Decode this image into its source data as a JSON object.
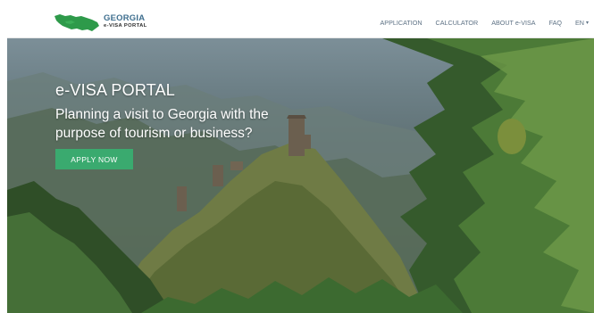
{
  "header": {
    "logo": {
      "line1": "GEORGIA",
      "line2": "e-VISA PORTAL"
    },
    "nav": [
      {
        "label": "APPLICATION"
      },
      {
        "label": "CALCULATOR"
      },
      {
        "label": "ABOUT e-VISA"
      },
      {
        "label": "FAQ"
      }
    ],
    "language": {
      "label": "EN"
    }
  },
  "hero": {
    "title": "e-VISA PORTAL",
    "subtitle": "Planning a visit to Georgia with the purpose of tourism or business?",
    "cta_label": "APPLY NOW"
  },
  "colors": {
    "accent": "#3aaa6f",
    "logo_green": "#2e9a4a",
    "nav_text": "#5d7184"
  },
  "icons": [
    "georgia-map-icon",
    "chevron-down-icon"
  ]
}
